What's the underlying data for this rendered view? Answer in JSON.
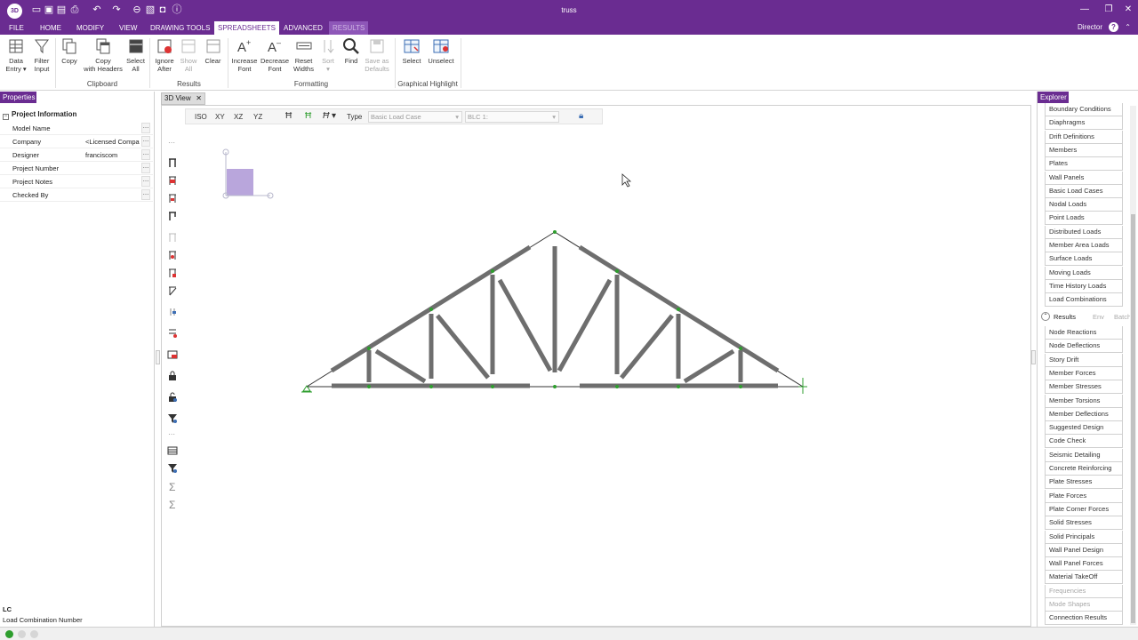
{
  "app": {
    "logo_text": "3D",
    "window_title": "truss",
    "user": "Director"
  },
  "menu": {
    "tabs": [
      {
        "label": "FILE"
      },
      {
        "label": "HOME"
      },
      {
        "label": "MODIFY"
      },
      {
        "label": "VIEW"
      },
      {
        "label": "DRAWING TOOLS"
      },
      {
        "label": "SPREADSHEETS"
      },
      {
        "label": "ADVANCED"
      },
      {
        "label": "RESULTS"
      }
    ],
    "active": "SPREADSHEETS"
  },
  "ribbon": {
    "buttons": [
      {
        "label": "Data\nEntry ▾"
      },
      {
        "label": "Filter\nInput"
      },
      {
        "label": "Copy"
      },
      {
        "label": "Copy\nwith Headers"
      },
      {
        "label": "Select\nAll"
      },
      {
        "label": "Ignore\nAfter"
      },
      {
        "label": "Show\nAll"
      },
      {
        "label": "Clear"
      },
      {
        "label": "Increase\nFont"
      },
      {
        "label": "Decrease\nFont"
      },
      {
        "label": "Reset\nWidths"
      },
      {
        "label": "Sort\n▾"
      },
      {
        "label": "Find"
      },
      {
        "label": "Save as\nDefaults"
      },
      {
        "label": "Select"
      },
      {
        "label": "Unselect"
      }
    ],
    "groups": {
      "clipboard": "Clipboard",
      "results": "Results",
      "formatting": "Formatting",
      "graphical": "Graphical Highlight"
    }
  },
  "properties": {
    "title": "Properties",
    "section": "Project Information",
    "rows": [
      {
        "key": "Model Name",
        "value": ""
      },
      {
        "key": "Company",
        "value": "<Licensed Compa"
      },
      {
        "key": "Designer",
        "value": "franciscom"
      },
      {
        "key": "Project Number",
        "value": ""
      },
      {
        "key": "Project Notes",
        "value": ""
      },
      {
        "key": "Checked By",
        "value": ""
      }
    ],
    "footer_title": "LC",
    "footer_desc": "Load Combination Number"
  },
  "view": {
    "tab_label": "3D View",
    "close": "✕",
    "toolbar": {
      "iso": "ISO",
      "xy": "XY",
      "xz": "XZ",
      "yz": "YZ",
      "type_label": "Type",
      "type_value": "Basic Load Case",
      "case_value": "BLC 1:"
    }
  },
  "explorer": {
    "title": "Explorer",
    "model_items": [
      "Boundary Conditions",
      "Diaphragms",
      "Drift Definitions",
      "Members",
      "Plates",
      "Wall Panels",
      "Basic Load Cases",
      "Nodal Loads",
      "Point Loads",
      "Distributed Loads",
      "Member Area Loads",
      "Surface Loads",
      "Moving Loads",
      "Time History Loads",
      "Load Combinations"
    ],
    "results_header": {
      "label": "Results",
      "env": "Env",
      "batch": "Batch"
    },
    "result_items": [
      "Node Reactions",
      "Node Deflections",
      "Story Drift",
      "Member Forces",
      "Member Stresses",
      "Member Torsions",
      "Member Deflections",
      "Suggested Design",
      "Code Check",
      "Seismic Detailing",
      "Concrete Reinforcing",
      "Plate Stresses",
      "Plate Forces",
      "Plate Corner Forces",
      "Solid Stresses",
      "Solid Principals",
      "Wall Panel Design",
      "Wall Panel Forces",
      "Material TakeOff",
      "Frequencies",
      "Mode Shapes",
      "Connection Results"
    ],
    "disabled_results": [
      "Frequencies",
      "Mode Shapes"
    ]
  },
  "colors": {
    "brand": "#6a2c91",
    "member": "#6e6e6e",
    "node": "#2e9e2e"
  }
}
